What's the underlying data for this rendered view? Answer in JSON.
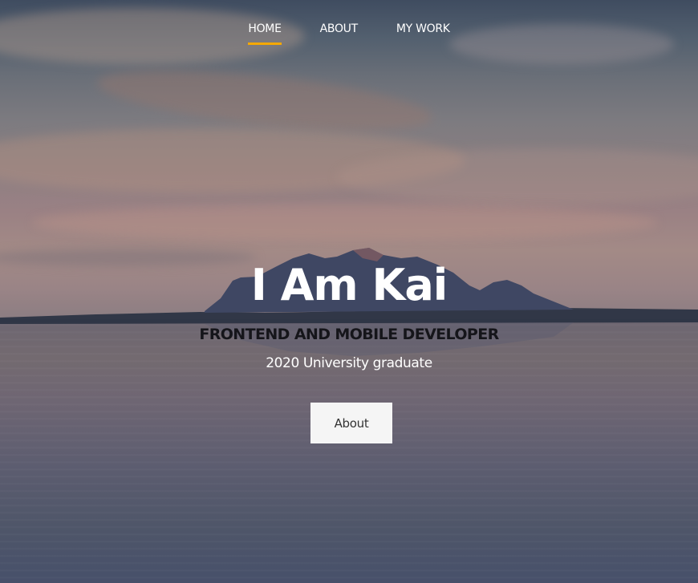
{
  "nav": {
    "items": [
      {
        "label": "HOME",
        "active": true
      },
      {
        "label": "ABOUT",
        "active": false
      },
      {
        "label": "MY WORK",
        "active": false
      }
    ],
    "active_color": "#f5a800"
  },
  "hero": {
    "title": "I Am Kai",
    "subtitle": "FRONTEND AND MOBILE DEVELOPER",
    "tagline": "2020 University graduate",
    "button_label": "About"
  },
  "background": {
    "scene": "sunset-lake-with-mountain-island",
    "sky_color": "#53606f",
    "water_color": "#5d5d70"
  }
}
